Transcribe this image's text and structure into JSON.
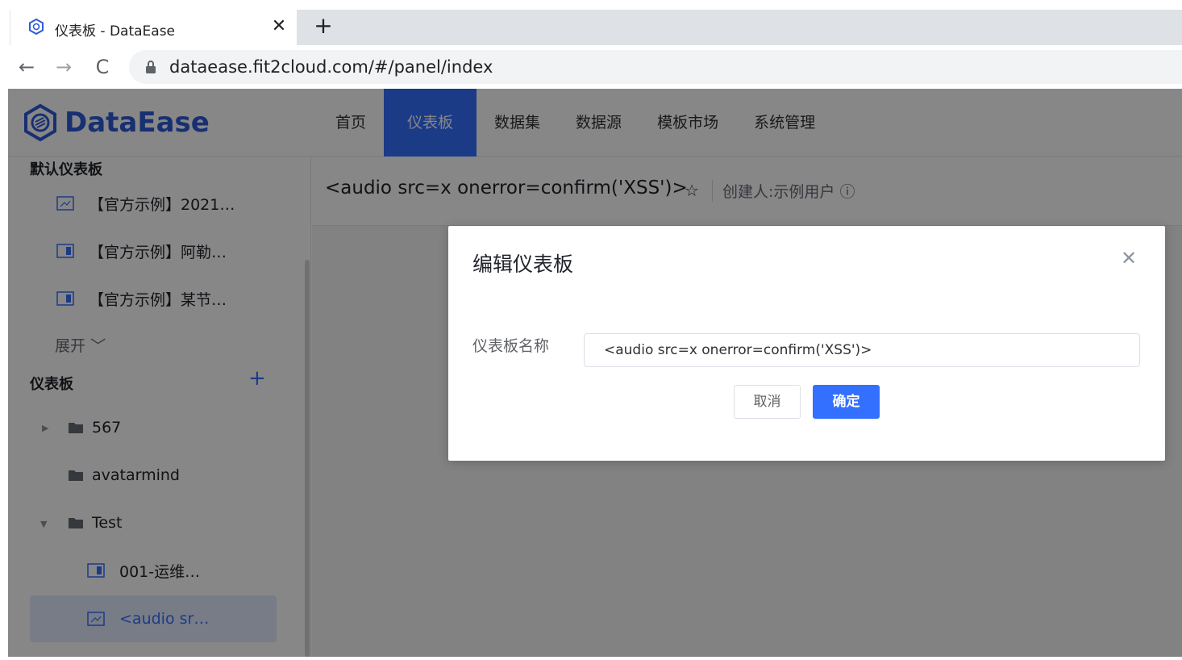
{
  "browser": {
    "tab_title": "仪表板 - DataEase",
    "tab_close": "✕",
    "new_tab": "+",
    "url": "dataease.fit2cloud.com/#/panel/index",
    "nav": {
      "back": "←",
      "forward": "→",
      "reload": "C"
    }
  },
  "header": {
    "logo_text": "DataEase",
    "menu": [
      "首页",
      "仪表板",
      "数据集",
      "数据源",
      "模板市场",
      "系统管理"
    ],
    "active_menu": "仪表板"
  },
  "sidebar": {
    "default_section": "默认仪表板",
    "default_items": [
      "【官方示例】2021…",
      "【官方示例】阿勒…",
      "【官方示例】某节…"
    ],
    "expand_label": "展开",
    "panel_section": "仪表板",
    "add_icon": "+",
    "tree": {
      "folder_567": "567",
      "folder_avatarmind": "avatarmind",
      "folder_test": "Test",
      "item_001": "001-运维…",
      "item_selected": "<audio sr…"
    }
  },
  "content": {
    "panel_title": "<audio src=x onerror=confirm('XSS')>",
    "star_icon": "☆",
    "creator": "创建人:示例用户 ⓘ"
  },
  "dialog": {
    "title": "编辑仪表板",
    "close": "✕",
    "field_label": "仪表板名称",
    "field_value": "<audio src=x onerror=confirm('XSS')>",
    "cancel": "取消",
    "confirm": "确定"
  },
  "colors": {
    "accent": "#3370ff",
    "logo": "#2e5bd8",
    "mask": "rgba(0,0,0,0.47)"
  }
}
